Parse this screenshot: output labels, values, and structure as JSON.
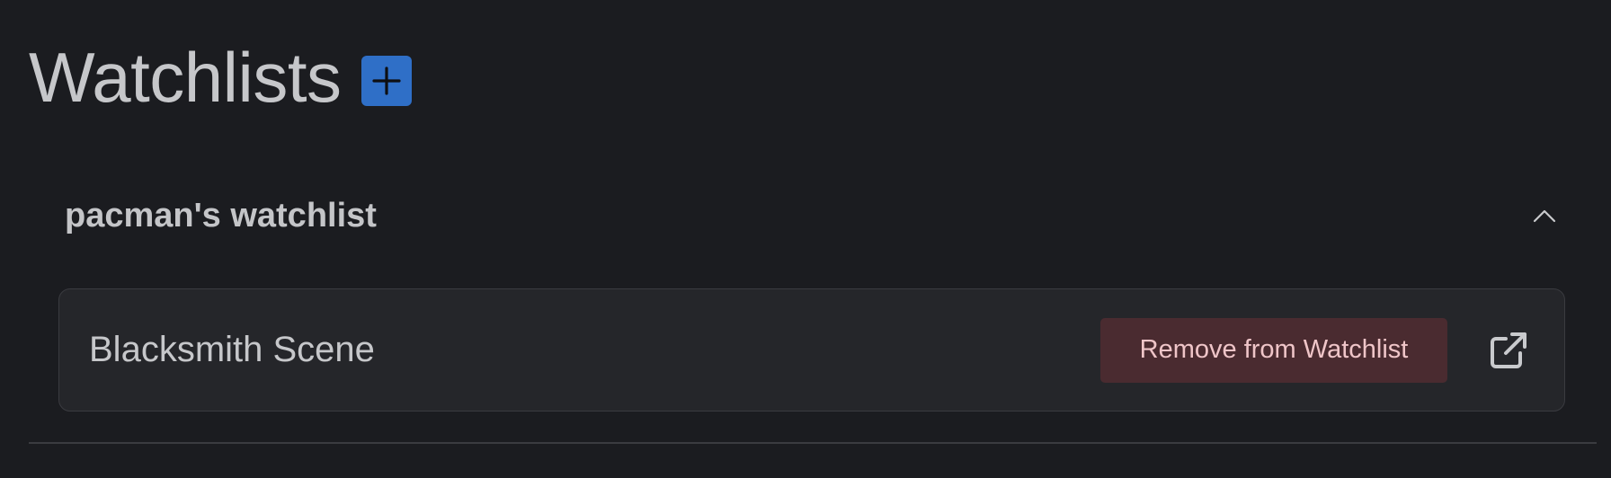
{
  "page": {
    "title": "Watchlists",
    "add_button_icon": "plus-icon"
  },
  "watchlists": [
    {
      "name": "pacman's watchlist",
      "toggle_icon": "chevron-up-icon",
      "expanded": true,
      "items": [
        {
          "title": "Blacksmith Scene",
          "remove_label": "Remove from Watchlist",
          "link_icon": "external-link-icon"
        }
      ]
    }
  ],
  "colors": {
    "background": "#1b1c20",
    "accent": "#2f6fc7",
    "danger_bg": "#4a2b30",
    "danger_text": "#efc5c8"
  }
}
